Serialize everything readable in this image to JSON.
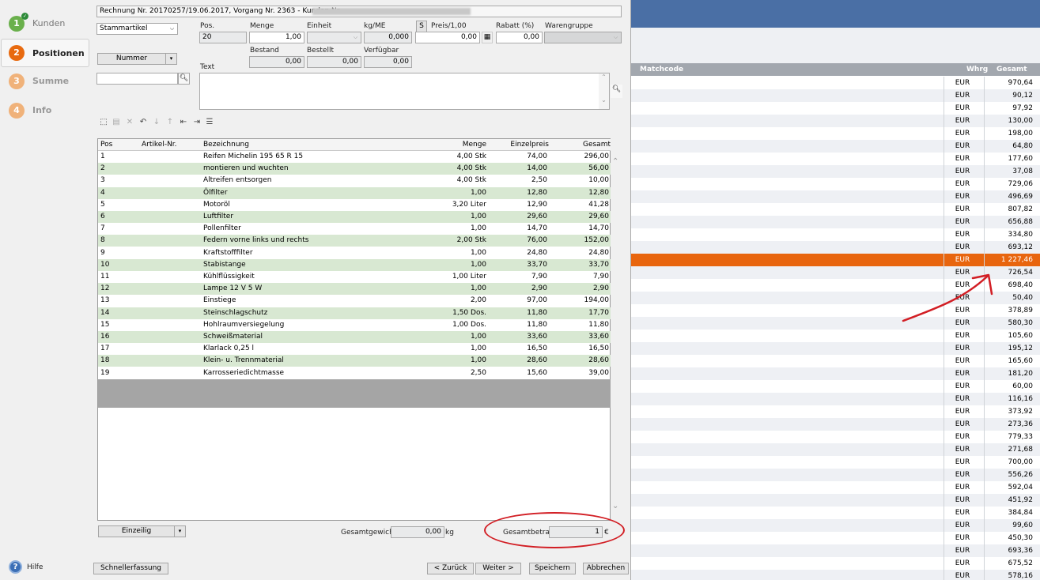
{
  "dialog": {
    "title_field": "Rechnung Nr. 20170257/19.06.2017, Vorgang Nr. 2363 - Kunden Nr",
    "steps": [
      {
        "num": "1",
        "label": "Kunden",
        "color": "#6ab04c"
      },
      {
        "num": "2",
        "label": "Positionen",
        "color": "#e86a10"
      },
      {
        "num": "3",
        "label": "Summe",
        "color": "#f0b27a"
      },
      {
        "num": "4",
        "label": "Info",
        "color": "#f0b27a"
      }
    ],
    "article_type": "Stammartikel",
    "search_mode": "Nummer",
    "search_value": "",
    "fields": {
      "pos_label": "Pos.",
      "pos_value": "20",
      "menge_label": "Menge",
      "menge_value": "1,00",
      "einheit_label": "Einheit",
      "einheit_value": "",
      "kgme_label": "kg/ME",
      "kgme_value": "0,000",
      "s_label": "S",
      "preis_label": "Preis/1,00",
      "preis_value": "0,00",
      "rabatt_label": "Rabatt (%)",
      "rabatt_value": "0,00",
      "warengruppe_label": "Warengruppe",
      "warengruppe_value": "",
      "bestand_label": "Bestand",
      "bestand_value": "0,00",
      "bestellt_label": "Bestellt",
      "bestellt_value": "0,00",
      "verfuegbar_label": "Verfügbar",
      "verfuegbar_value": "0,00",
      "text_label": "Text",
      "text_value": ""
    },
    "grid": {
      "headers": {
        "pos": "Pos",
        "artikel": "Artikel-Nr.",
        "bez": "Bezeichnung",
        "menge": "Menge",
        "einzel": "Einzelpreis",
        "gesamt": "Gesamt"
      },
      "rows": [
        {
          "pos": "1",
          "bez": "Reifen Michelin 195 65 R 15",
          "menge": "4,00 Stk",
          "einzel": "74,00",
          "gesamt": "296,00"
        },
        {
          "pos": "2",
          "bez": "montieren und wuchten",
          "menge": "4,00 Stk",
          "einzel": "14,00",
          "gesamt": "56,00"
        },
        {
          "pos": "3",
          "bez": "Altreifen entsorgen",
          "menge": "4,00 Stk",
          "einzel": "2,50",
          "gesamt": "10,00"
        },
        {
          "pos": "4",
          "bez": "Ölfilter",
          "menge": "1,00",
          "einzel": "12,80",
          "gesamt": "12,80"
        },
        {
          "pos": "5",
          "bez": "Motoröl",
          "menge": "3,20 Liter",
          "einzel": "12,90",
          "gesamt": "41,28"
        },
        {
          "pos": "6",
          "bez": "Luftfilter",
          "menge": "1,00",
          "einzel": "29,60",
          "gesamt": "29,60"
        },
        {
          "pos": "7",
          "bez": "Pollenfilter",
          "menge": "1,00",
          "einzel": "14,70",
          "gesamt": "14,70"
        },
        {
          "pos": "8",
          "bez": "Federn vorne links und rechts",
          "menge": "2,00 Stk",
          "einzel": "76,00",
          "gesamt": "152,00"
        },
        {
          "pos": "9",
          "bez": "Kraftstofffilter",
          "menge": "1,00",
          "einzel": "24,80",
          "gesamt": "24,80"
        },
        {
          "pos": "10",
          "bez": "Stabistange",
          "menge": "1,00",
          "einzel": "33,70",
          "gesamt": "33,70"
        },
        {
          "pos": "11",
          "bez": "Kühlflüssigkeit",
          "menge": "1,00 Liter",
          "einzel": "7,90",
          "gesamt": "7,90"
        },
        {
          "pos": "12",
          "bez": "Lampe 12 V 5 W",
          "menge": "1,00",
          "einzel": "2,90",
          "gesamt": "2,90"
        },
        {
          "pos": "13",
          "bez": "Einstiege",
          "menge": "2,00",
          "einzel": "97,00",
          "gesamt": "194,00"
        },
        {
          "pos": "14",
          "bez": "Steinschlagschutz",
          "menge": "1,50 Dos.",
          "einzel": "11,80",
          "gesamt": "17,70"
        },
        {
          "pos": "15",
          "bez": "Hohlraumversiegelung",
          "menge": "1,00 Dos.",
          "einzel": "11,80",
          "gesamt": "11,80"
        },
        {
          "pos": "16",
          "bez": "Schweißmaterial",
          "menge": "1,00",
          "einzel": "33,60",
          "gesamt": "33,60"
        },
        {
          "pos": "17",
          "bez": "Klarlack 0,25 l",
          "menge": "1,00",
          "einzel": "16,50",
          "gesamt": "16,50"
        },
        {
          "pos": "18",
          "bez": "Klein- u. Trennmaterial",
          "menge": "1,00",
          "einzel": "28,60",
          "gesamt": "28,60"
        },
        {
          "pos": "19",
          "bez": "Karrosseriedichtmasse",
          "menge": "2,50",
          "einzel": "15,60",
          "gesamt": "39,00"
        }
      ]
    },
    "footer": {
      "mode": "Einzeilig",
      "gesamtgewicht_label": "Gesamtgewicht",
      "gesamtgewicht_value": "0,00",
      "gewicht_unit": "kg",
      "gesamtbetrag_label": "Gesamtbetrag",
      "gesamtbetrag_value": "1",
      "currency": "€",
      "help": "Hilfe",
      "schnell": "Schnellerfassung",
      "back": "< Zurück",
      "next": "Weiter >",
      "save": "Speichern",
      "cancel": "Abbrechen"
    }
  },
  "background_list": {
    "headers": {
      "matchcode": "Matchcode",
      "whrg": "Whrg",
      "gesamt": "Gesamt"
    },
    "currency": "EUR",
    "highlight_color": "#e8650e",
    "values": [
      "970,64",
      "90,12",
      "97,92",
      "130,00",
      "198,00",
      "64,80",
      "177,60",
      "37,08",
      "729,06",
      "496,69",
      "807,82",
      "656,88",
      "334,80",
      "693,12",
      "1 227,46",
      "726,54",
      "698,40",
      "50,40",
      "378,89",
      "580,30",
      "105,60",
      "195,12",
      "165,60",
      "181,20",
      "60,00",
      "116,16",
      "373,92",
      "273,36",
      "779,33",
      "271,68",
      "700,00",
      "556,26",
      "592,04",
      "451,92",
      "384,84",
      "99,60",
      "450,30",
      "693,36",
      "675,52",
      "578,16"
    ],
    "highlight_index": 14
  }
}
